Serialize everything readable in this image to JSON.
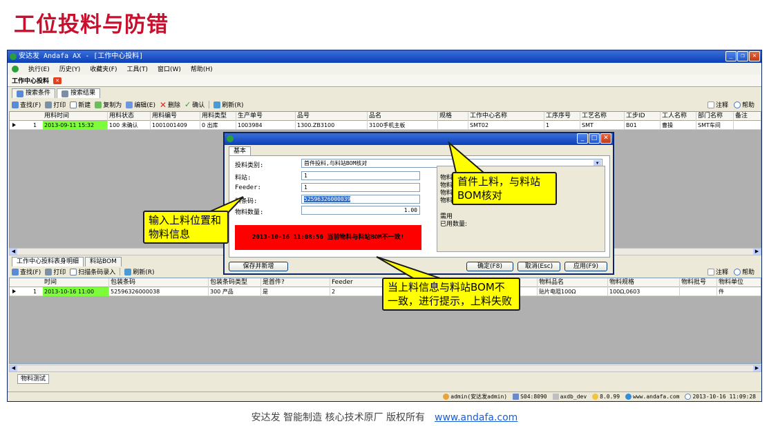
{
  "slide": {
    "title": "工位投料与防错"
  },
  "window": {
    "title": "安达发 Andafa AX - [工作中心投料]"
  },
  "menu": [
    "执行(E)",
    "历史(Y)",
    "收藏夹(F)",
    "工具(T)",
    "窗口(W)",
    "帮助(H)"
  ],
  "doc_tab": "工作中心投料",
  "subtabs": [
    "搜索条件",
    "搜索结果"
  ],
  "toolbar1": {
    "find": "查找(F)",
    "print": "打印",
    "new": "新建",
    "copy_as": "复制为",
    "edit": "编辑(E)",
    "delete": "删除",
    "confirm": "确认",
    "refresh": "刷新(R)",
    "note": "注释",
    "help": "帮助"
  },
  "top_grid": {
    "columns": [
      "用料时间",
      "用料状态",
      "用料编号",
      "用料类型",
      "生产单号",
      "品号",
      "品名",
      "规格",
      "工作中心名称",
      "工序序号",
      "工艺名称",
      "工步ID",
      "工人名称",
      "部门名称",
      "备注"
    ],
    "rows": [
      {
        "no": "1",
        "time": "2013-09-11 15:32",
        "status": "100 未确认",
        "code": "1001001409",
        "type": "0 出库",
        "order": "1003984",
        "item_no": "1300.ZB3100",
        "item_name": "3100手机主板",
        "spec": "",
        "wc_name": "SMT02",
        "op_seq": "1",
        "craft": "SMT",
        "step_id": "B01",
        "worker": "曹操",
        "dept": "SMT车间",
        "remark": ""
      }
    ]
  },
  "bottom_tabs": [
    "工作中心投料表身明细",
    "料站BOM"
  ],
  "toolbar2": {
    "find": "查找(F)",
    "print": "打印",
    "scan": "扫描条码录入",
    "refresh": "刷新(R)",
    "note": "注释",
    "help": "帮助"
  },
  "bottom_grid": {
    "columns": [
      "时间",
      "包装条码",
      "包装条码类型",
      "是首件?",
      "Feeder",
      "物料品名",
      "物料规格",
      "物料批号",
      "物料单位"
    ],
    "rows": [
      {
        "no": "1",
        "time": "2013-10-16 11:00",
        "barcode": "52596326000038",
        "barcode_type": "300 产品",
        "first": "是",
        "feeder": "2",
        "mat_name": "贴片电阻100Ω",
        "mat_spec": "100Ω,0603",
        "mat_lot": "",
        "mat_unit": "件"
      }
    ]
  },
  "bottom_status_tab": "物料测试",
  "status_bar": {
    "user": "admin(安达发admin)",
    "server": "S04:8090",
    "db": "axdb_dev",
    "version": "8.0.99",
    "site": "www.andafa.com",
    "time": "2013-10-16 11:09:28"
  },
  "dialog": {
    "tab": "基本",
    "fields": {
      "type_label": "投料类别:",
      "type_value": "首件投料,与料站BOM核对",
      "station_label": "料站:",
      "station_value": "1",
      "feeder_label": "Feeder:",
      "feeder_value": "1",
      "barcode_label": "料条码:",
      "barcode_value": "52596326000039",
      "qty_label": "物料数量:",
      "qty_value": "1.00"
    },
    "info_lines": [
      "物料",
      "物料",
      "物料",
      "物料",
      "需用",
      "已用数量:"
    ],
    "error": "2013-10-16 11:08:56 当前物料与料站BOM不一致!",
    "buttons": {
      "save_new": "保存并新增",
      "ok": "确定(F8)",
      "cancel": "取消(Esc)",
      "apply": "应用(F9)"
    }
  },
  "callouts": {
    "first_piece": "首件上料，与料站BOM核对",
    "input": "输入上料位置和物料信息",
    "mismatch": "当上料信息与料站BOM不一致，进行提示，上料失败"
  },
  "footer": {
    "text": "安达发   智能制造 核心技术原厂   版权所有",
    "link": "www.andafa.com"
  },
  "colors": {
    "title_red": "#c8102e",
    "highlight_green": "#7cfc3a",
    "error_red": "#ff0000",
    "callout_yellow": "#ffff00"
  }
}
